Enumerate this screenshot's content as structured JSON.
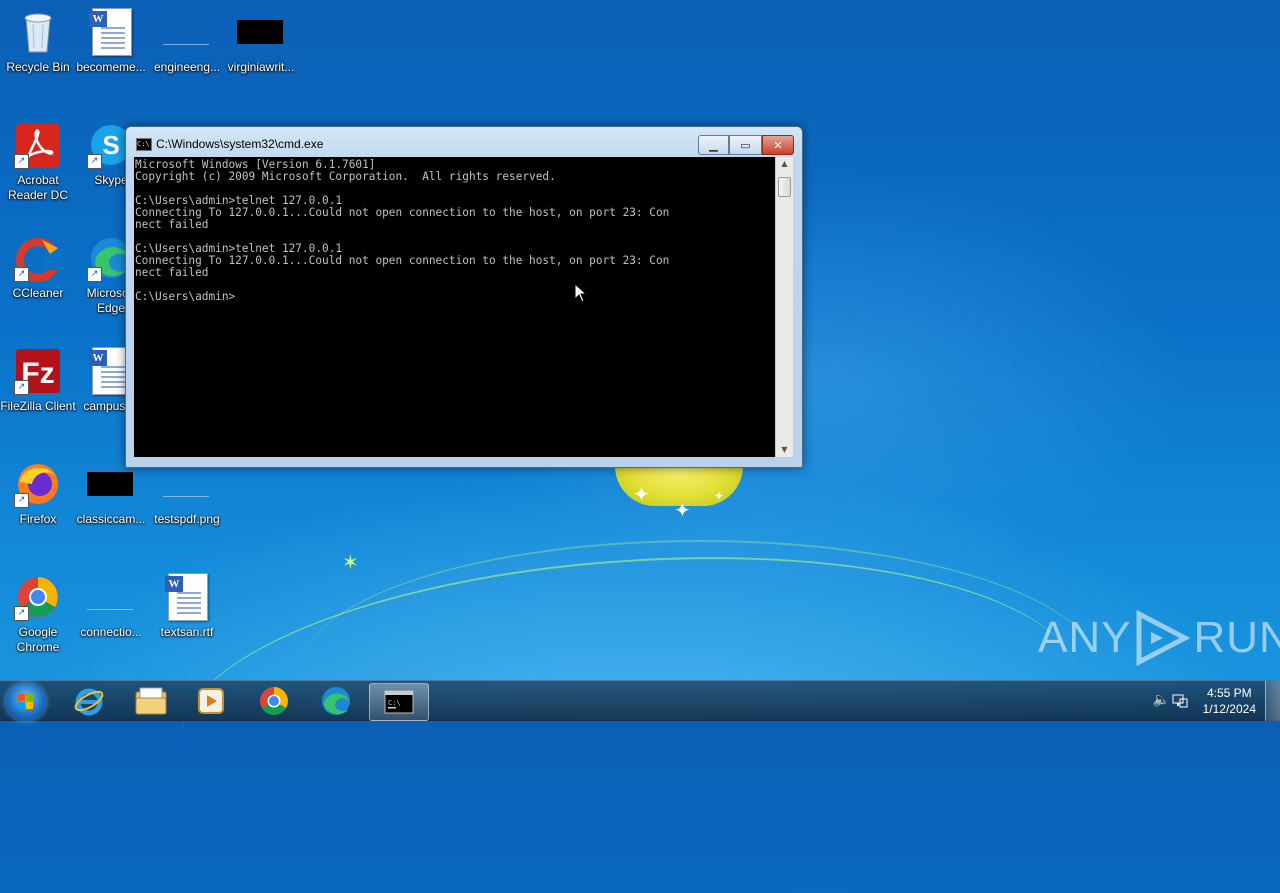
{
  "desktop": {
    "icons": [
      {
        "label": "Recycle Bin"
      },
      {
        "label": "becomeme..."
      },
      {
        "label": "engineeng..."
      },
      {
        "label": "virginiawrit..."
      },
      {
        "label": "Acrobat Reader DC"
      },
      {
        "label": "Skype"
      },
      {
        "label": "CCleaner"
      },
      {
        "label": "Microsoft Edge"
      },
      {
        "label": "FileZilla Client"
      },
      {
        "label": "campusr..."
      },
      {
        "label": "Firefox"
      },
      {
        "label": "classiccam..."
      },
      {
        "label": "testspdf.png"
      },
      {
        "label": "Google Chrome"
      },
      {
        "label": "connectio..."
      },
      {
        "label": "textsan.rtf"
      }
    ],
    "watermark": "ANY RUN"
  },
  "window": {
    "title": "C:\\Windows\\system32\\cmd.exe",
    "console_lines": [
      "Microsoft Windows [Version 6.1.7601]",
      "Copyright (c) 2009 Microsoft Corporation.  All rights reserved.",
      "",
      "C:\\Users\\admin>telnet 127.0.0.1",
      "Connecting To 127.0.0.1...Could not open connection to the host, on port 23: Con",
      "nect failed",
      "",
      "C:\\Users\\admin>telnet 127.0.0.1",
      "Connecting To 127.0.0.1...Could not open connection to the host, on port 23: Con",
      "nect failed",
      "",
      "C:\\Users\\admin>"
    ]
  },
  "taskbar": {
    "apps": [
      "start",
      "internet-explorer",
      "file-explorer",
      "media-player",
      "chrome",
      "edge",
      "cmd"
    ],
    "time": "4:55 PM",
    "date": "1/12/2024"
  }
}
